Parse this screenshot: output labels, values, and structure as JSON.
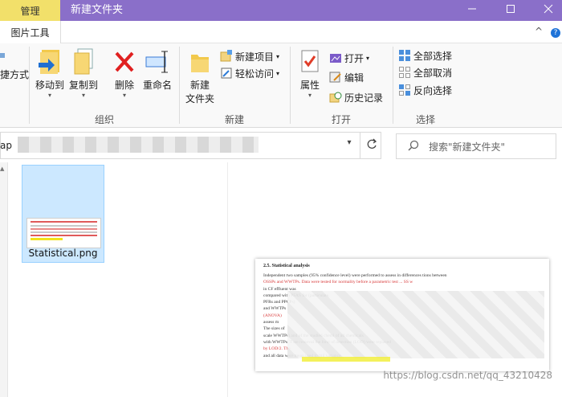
{
  "titlebar": {
    "context_tab": "管理",
    "title": "新建文件夹",
    "minimize": "—",
    "maximize": "☐",
    "close": "✕"
  },
  "ribbon_tabs": {
    "picture_tools": "图片工具",
    "collapse": "^",
    "help": "?"
  },
  "left_partial": {
    "label": "捷方式"
  },
  "organize": {
    "move_to": "移动到",
    "copy_to": "复制到",
    "delete": "删除",
    "rename": "重命名",
    "label": "组织"
  },
  "new_group": {
    "new_folder_line1": "新建",
    "new_folder_line2": "文件夹",
    "new_item": "新建项目",
    "easy_access": "轻松访问",
    "label": "新建"
  },
  "open_group": {
    "properties": "属性",
    "open": "打开",
    "edit": "编辑",
    "history": "历史记录",
    "label": "打开"
  },
  "select_group": {
    "select_all": "全部选择",
    "select_none": "全部取消",
    "invert": "反向选择",
    "label": "选择"
  },
  "address": {
    "prefix": "ap"
  },
  "search": {
    "placeholder": "搜索\"新建文件夹\""
  },
  "files": [
    {
      "name": "Statistical.png"
    }
  ],
  "preview": {
    "heading": "2.5. Statistical analysis",
    "lines": [
      "Independent two samples      (95% confidence level) were performed to assess  in  differences      tions between",
      "OSSPs  and  WWTPs. Data were tested for normality before a parametric test  ...   SS  w",
      "                                                                      in  CF effluent  was",
      "compared  with  PFAS                                                  for                           (particulate,",
      "PFRs and PPCPs)",
      "and  WWTPs",
      "(ANOVA)",
      "assess m",
      "The  sizes  of",
      "scale WWTPs) and                                of the studied chemi            of all chemicals",
      "with WWTPs. T             ate removal                               the limit of detection (LOD) were replaced",
      "by LOD/2. The",
      "and all data were       mean        used to mil variance"
    ]
  },
  "watermark": "https://blog.csdn.net/qq_43210428"
}
